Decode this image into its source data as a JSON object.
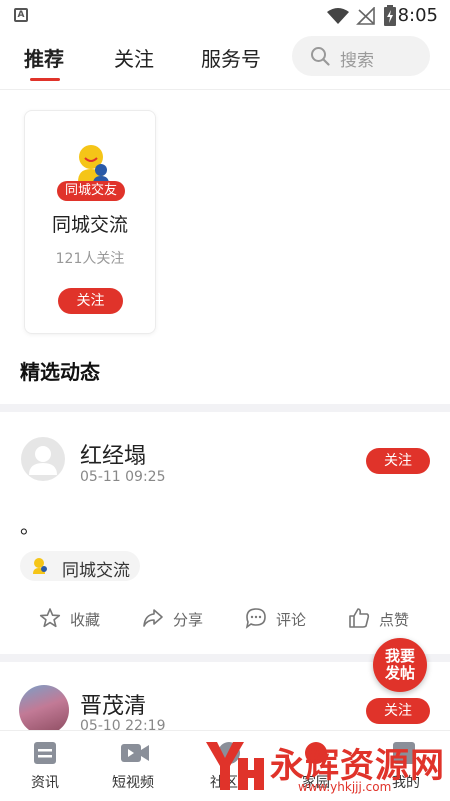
{
  "status_bar": {
    "time": "8:05",
    "app_icon": "A"
  },
  "tabs": [
    {
      "label": "推荐",
      "active": true
    },
    {
      "label": "关注",
      "active": false
    },
    {
      "label": "服务号",
      "active": false
    }
  ],
  "search": {
    "placeholder": "搜索"
  },
  "group_card": {
    "badge": "同城交友",
    "name": "同城交流",
    "followers": "121人关注",
    "follow_label": "关注"
  },
  "section_title": "精选动态",
  "posts": [
    {
      "author": "红经塌",
      "time": "05-11 09:25",
      "follow_label": "关注",
      "text": "。",
      "topic": "同城交流",
      "actions": [
        "收藏",
        "分享",
        "评论",
        "点赞"
      ]
    },
    {
      "author": "晋茂清",
      "time": "05-10 22:19",
      "follow_label": "关注"
    }
  ],
  "fab": {
    "line1": "我要",
    "line2": "发帖"
  },
  "bottom_nav": [
    {
      "label": "资讯",
      "icon": "news-icon"
    },
    {
      "label": "短视频",
      "icon": "video-icon"
    },
    {
      "label": "社区",
      "icon": "community-icon"
    },
    {
      "label": "家园",
      "icon": "home-icon"
    },
    {
      "label": "我的",
      "icon": "profile-icon"
    }
  ],
  "watermark": {
    "brand": "永辉资源网",
    "url": "www.yhkjjj.com"
  },
  "colors": {
    "accent": "#e0332a",
    "muted": "#999999",
    "background": "#ffffff"
  }
}
